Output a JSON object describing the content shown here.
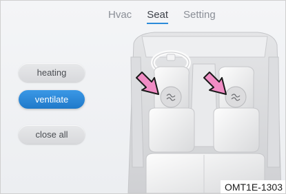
{
  "tabs": [
    {
      "label": "Hvac",
      "active": false
    },
    {
      "label": "Seat",
      "active": true
    },
    {
      "label": "Setting",
      "active": false
    }
  ],
  "buttons": {
    "heating": "heating",
    "ventilate": "ventilate",
    "close_all": "close all"
  },
  "active_mode": "ventilate",
  "seats": {
    "driver": {
      "mode_icon": "seat-ventilation-icon",
      "pointer": "pink-arrow-icon"
    },
    "passenger": {
      "mode_icon": "seat-ventilation-icon",
      "pointer": "pink-arrow-icon"
    }
  },
  "caption": "OMT1E-1303",
  "colors": {
    "accent": "#2b8ad9",
    "active_button": "#2582d2",
    "arrow": "#f08cc4"
  }
}
